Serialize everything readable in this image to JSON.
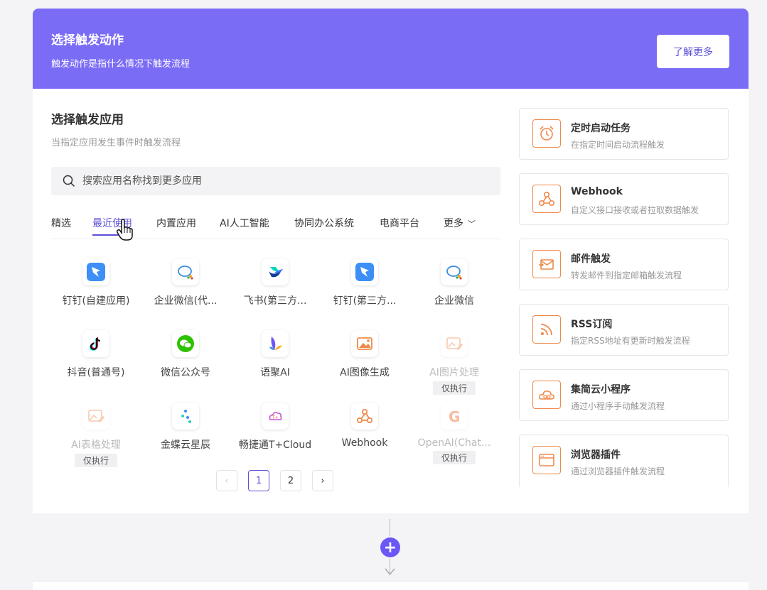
{
  "banner": {
    "title": "选择触发动作",
    "subtitle": "触发动作是指什么情况下触发流程",
    "learn_more": "了解更多"
  },
  "section": {
    "title": "选择触发应用",
    "subtitle": "当指定应用发生事件时触发流程"
  },
  "search": {
    "placeholder": "搜索应用名称找到更多应用",
    "value": ""
  },
  "tabs": [
    "精选",
    "最近使用",
    "内置应用",
    "AI人工智能",
    "协同办公系统",
    "电商平台",
    "更多"
  ],
  "active_tab": "最近使用",
  "apps": [
    {
      "name": "钉钉(自建应用)",
      "icon": "dingtalk-icon",
      "dim": false
    },
    {
      "name": "企业微信(代...",
      "icon": "wecom-icon",
      "dim": false
    },
    {
      "name": "飞书(第三方...",
      "icon": "feishu-icon",
      "dim": false
    },
    {
      "name": "钉钉(第三方...",
      "icon": "dingtalk-icon",
      "dim": false
    },
    {
      "name": "企业微信",
      "icon": "wecom-icon",
      "dim": false
    },
    {
      "name": "抖音(普通号)",
      "icon": "douyin-icon",
      "dim": false
    },
    {
      "name": "微信公众号",
      "icon": "wechat-icon",
      "dim": false
    },
    {
      "name": "语聚AI",
      "icon": "yuju-ai-icon",
      "dim": false
    },
    {
      "name": "AI图像生成",
      "icon": "ai-image-gen-icon",
      "dim": false
    },
    {
      "name": "AI图片处理",
      "icon": "ai-image-process-icon",
      "dim": true,
      "badge": "仅执行"
    },
    {
      "name": "AI表格处理",
      "icon": "ai-table-process-icon",
      "dim": true,
      "badge": "仅执行"
    },
    {
      "name": "金蝶云星辰",
      "icon": "kingdee-icon",
      "dim": false
    },
    {
      "name": "畅捷通T+Cloud",
      "icon": "chanjet-icon",
      "dim": false
    },
    {
      "name": "Webhook",
      "icon": "webhook-icon",
      "dim": false
    },
    {
      "name": "OpenAI(Chat...",
      "icon": "openai-icon",
      "dim": true,
      "badge": "仅执行"
    }
  ],
  "pagination": {
    "prev": "‹",
    "pages": [
      "1",
      "2"
    ],
    "current": "1",
    "next": "›"
  },
  "trigger_cards": [
    {
      "title": "定时启动任务",
      "subtitle": "在指定时间启动流程触发",
      "icon": "alarm-clock-icon"
    },
    {
      "title": "Webhook",
      "subtitle": "自定义接口接收或者拉取数据触发",
      "icon": "webhook-icon"
    },
    {
      "title": "邮件触发",
      "subtitle": "转发邮件到指定邮箱触发流程",
      "icon": "mail-icon"
    },
    {
      "title": "RSS订阅",
      "subtitle": "指定RSS地址有更新时触发流程",
      "icon": "rss-icon"
    },
    {
      "title": "集简云小程序",
      "subtitle": "通过小程序手动触发流程",
      "icon": "cloud-icon"
    },
    {
      "title": "浏览器插件",
      "subtitle": "通过浏览器插件触发流程",
      "icon": "browser-icon"
    }
  ],
  "flow": {
    "add_symbol": "+"
  },
  "colors": {
    "brand": "#7b6cf6",
    "accent": "#5b4fd6",
    "trigger_orange": "#ef8a4b"
  }
}
